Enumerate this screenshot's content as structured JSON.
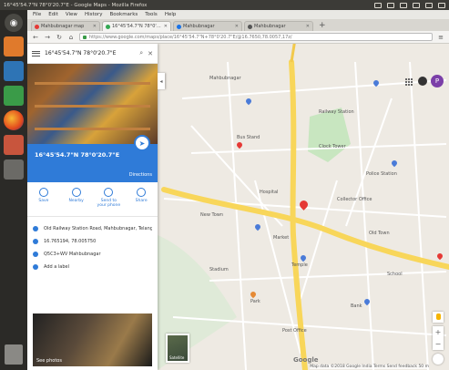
{
  "os": {
    "window_title": "16°45'54.7\"N 78°0'20.7\"E - Google Maps - Mozilla Firefox"
  },
  "browser": {
    "menu": [
      "File",
      "Edit",
      "View",
      "History",
      "Bookmarks",
      "Tools",
      "Help"
    ],
    "tabs": [
      {
        "label": "Mahbubnagar map",
        "active": false,
        "color": "#e53935"
      },
      {
        "label": "16°45'54.7\"N 78°0'20.7\"E",
        "active": true,
        "color": "#34a853"
      },
      {
        "label": "Mahbubnagar",
        "active": false,
        "color": "#1a73e8"
      },
      {
        "label": "Mahbubnagar",
        "active": false,
        "color": "#555555"
      }
    ],
    "new_tab": "+",
    "url": "https://www.google.com/maps/place/16°45'54.7\"N+78°0'20.7\"E/@16.7650,78.0057,17z/"
  },
  "panel": {
    "search_value": "16°45'54.7\"N 78°0'20.7\"E",
    "place_name": "16°45'54.7\"N 78°0'20.7\"E",
    "directions_label": "Directions",
    "actions": [
      {
        "label": "Save",
        "icon": "bookmark-icon"
      },
      {
        "label": "Nearby",
        "icon": "nearby-icon"
      },
      {
        "label": "Send to your phone",
        "icon": "phone-icon"
      },
      {
        "label": "Share",
        "icon": "share-icon"
      }
    ],
    "info": [
      {
        "text": "Old Railway Station Road, Mahbubnagar, Telangana 509001",
        "icon": "location-pin-icon"
      },
      {
        "text": "16.765194, 78.005750",
        "icon": "coordinates-icon"
      },
      {
        "text": "Q5C3+WV Mahbubnagar",
        "icon": "plus-code-icon"
      },
      {
        "text": "Add a label",
        "icon": "label-flag-icon"
      }
    ],
    "photos_label": "See photos"
  },
  "map": {
    "labels": [
      "Mahbubnagar",
      "Railway Station",
      "Bus Stand",
      "Clock Tower",
      "Police Station",
      "Hospital",
      "Collector Office",
      "New Town",
      "Old Town",
      "Market",
      "Stadium",
      "Temple",
      "School",
      "Park",
      "Bank",
      "Post Office"
    ],
    "google_logo": "Google",
    "satellite_label": "Satellite",
    "footer": "Map data ©2018 Google   India   Terms   Send feedback   50 m",
    "avatar_letter": "P",
    "zoom_in": "+",
    "zoom_out": "−"
  },
  "colors": {
    "accent": "#2f7bd8",
    "marker": "#e53935",
    "road_major": "#f8d65a",
    "park": "#c8e6c0"
  }
}
